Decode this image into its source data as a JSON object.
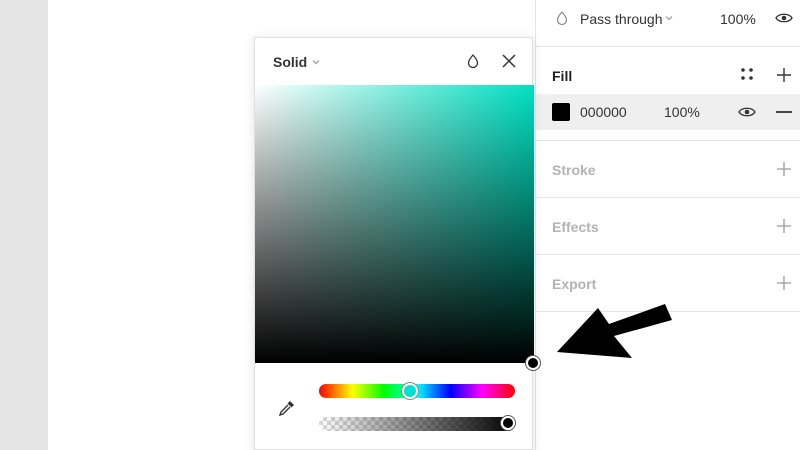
{
  "layer": {
    "blend_mode": "Pass through",
    "opacity": "100%"
  },
  "fill": {
    "title": "Fill",
    "hex": "000000",
    "opacity": "100%",
    "swatch_color": "#000000"
  },
  "sections": {
    "stroke": "Stroke",
    "effects": "Effects",
    "export": "Export"
  },
  "picker": {
    "type": "Solid",
    "hue_color": "#00e0c2"
  },
  "icons": {
    "layer": [
      "drop-icon",
      "chevron-down-icon",
      "eye-icon"
    ],
    "fill": [
      "grid-dots-icon",
      "plus-icon",
      "eye-icon",
      "minus-icon"
    ],
    "picker": [
      "chevron-down-icon",
      "drop-icon",
      "close-icon",
      "eyedropper-icon"
    ],
    "annotation": "arrow-pointer-icon"
  }
}
